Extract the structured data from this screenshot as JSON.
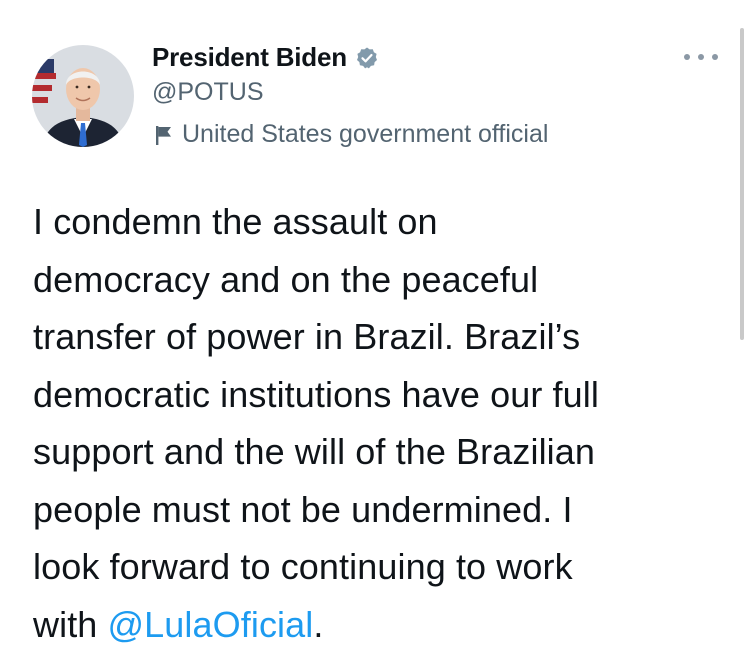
{
  "author": {
    "display_name": "President Biden",
    "handle": "@POTUS",
    "label": "United States government official",
    "verified_icon": "verified-badge-icon",
    "label_icon": "flag-icon"
  },
  "tweet": {
    "lines": [
      "I condemn the assault on",
      "democracy and on the peaceful",
      "transfer of power in Brazil. Brazil’s",
      "democratic institutions have our full",
      "support and the will of the Brazilian",
      "people must not be undermined. I",
      "look forward to continuing to work"
    ],
    "last_line_prefix": "with ",
    "mention": "@LulaOficial",
    "last_line_suffix": "."
  },
  "colors": {
    "text": "#0f1419",
    "secondary": "#536471",
    "link": "#1d9bf0",
    "verified": "#829aab"
  }
}
